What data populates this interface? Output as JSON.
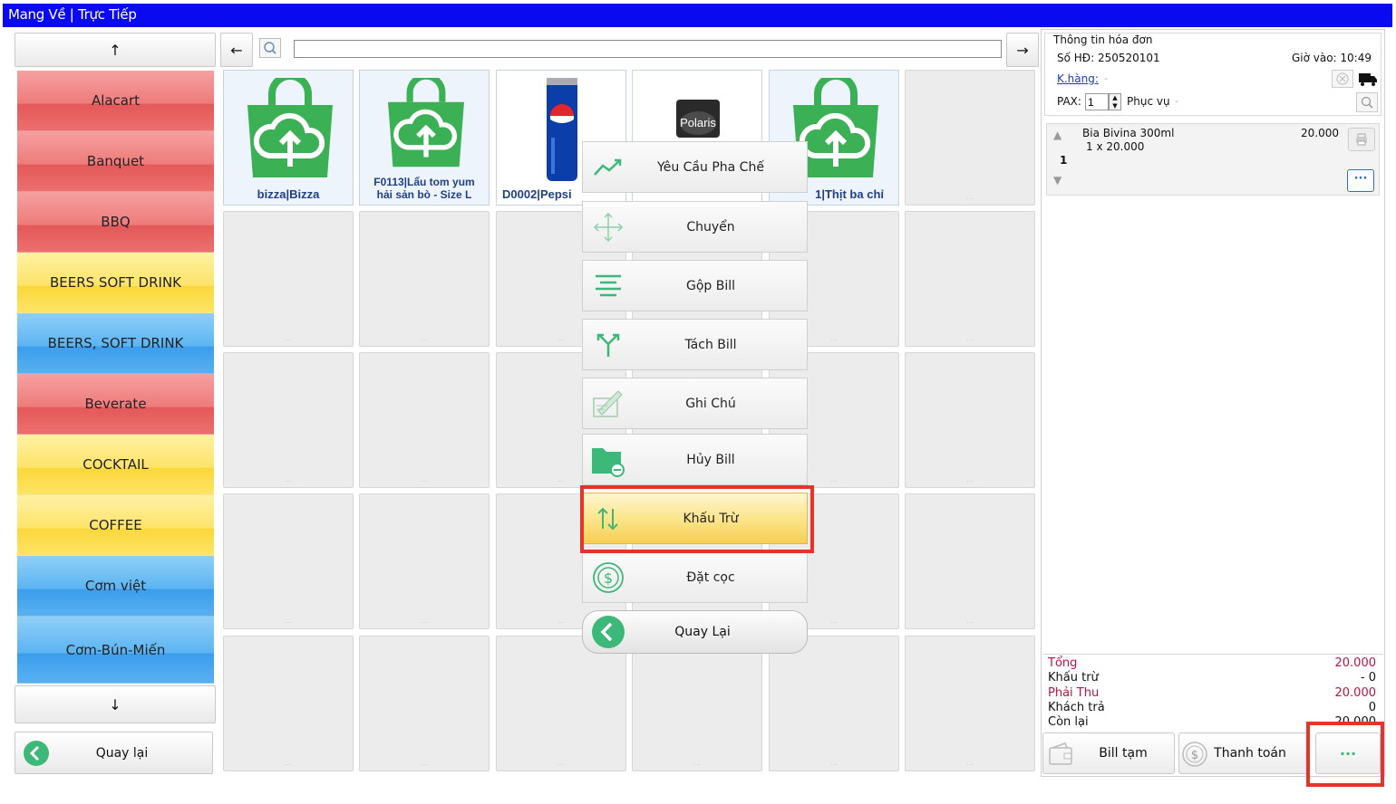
{
  "title": "Mang Về | Trực Tiếp",
  "sidebar": {
    "up_arrow": "↑",
    "down_arrow": "↓",
    "back_label": "Quay lại",
    "categories": [
      {
        "label": "Alacart",
        "color": "red"
      },
      {
        "label": "Banquet",
        "color": "red"
      },
      {
        "label": "BBQ",
        "color": "red"
      },
      {
        "label": "BEERS SOFT DRINK",
        "color": "yellow"
      },
      {
        "label": "BEERS, SOFT DRINK",
        "color": "blue"
      },
      {
        "label": "Beverate",
        "color": "red"
      },
      {
        "label": "COCKTAIL",
        "color": "yellow"
      },
      {
        "label": "COFFEE",
        "color": "yellow"
      },
      {
        "label": "Cơm việt",
        "color": "blue"
      },
      {
        "label": "Cơm-Bún-Miến",
        "color": "blue"
      }
    ]
  },
  "search": {
    "left_arrow": "←",
    "right_arrow": "→",
    "value": ""
  },
  "products": [
    {
      "label": "bizza|Bizza",
      "icon": "cloud-bag-icon"
    },
    {
      "label": "F0113|Lẩu tom yum hải sản bò - Size L",
      "icon": "cloud-bag-icon"
    },
    {
      "label": "D0002|Pepsi",
      "icon": "pepsi-can-icon"
    },
    {
      "label": "",
      "icon": "polaris-can-icon"
    },
    {
      "label": "1|Thịt ba chỉ",
      "icon": "cloud-bag-icon"
    }
  ],
  "tile_placeholder": "...",
  "menu": {
    "items": [
      {
        "label": "Yêu Cầu Pha Chế",
        "icon": "trend-line-icon"
      },
      {
        "label": "Chuyển",
        "icon": "move-arrows-icon"
      },
      {
        "label": "Gộp Bill",
        "icon": "merge-lines-icon"
      },
      {
        "label": "Tách Bill",
        "icon": "split-arrows-icon"
      },
      {
        "label": "Ghi Chú",
        "icon": "note-pen-icon"
      },
      {
        "label": "Hủy Bill",
        "icon": "folder-minus-icon"
      },
      {
        "label": "Khấu Trừ",
        "icon": "up-down-arrows-icon",
        "highlighted": true
      },
      {
        "label": "Đặt cọc",
        "icon": "dollar-coin-icon"
      }
    ],
    "back_label": "Quay Lại"
  },
  "invoice": {
    "header": "Thông tin hóa đơn",
    "number_label": "Số HĐ: 250520101",
    "time_label": "Giờ vào: 10:49",
    "customer_label": "K.hàng:",
    "customer_value": "-",
    "pax_label": "PAX:",
    "pax_value": "1",
    "service_label": "Phục vụ",
    "service_value": "-",
    "items": [
      {
        "name": "Bia Bivina 300ml",
        "price": "20.000",
        "detail": "1 x 20.000",
        "qty": "1"
      }
    ],
    "more_label": "···"
  },
  "summary": {
    "rows": [
      {
        "label": "Tổng",
        "value": "20.000",
        "color": "#c0143c"
      },
      {
        "label": "Khấu trừ",
        "value": "- 0",
        "color": "#111111"
      },
      {
        "label": "Phải Thu",
        "value": "20.000",
        "color": "#c0143c"
      },
      {
        "label": "Khách trả",
        "value": "0",
        "color": "#111111"
      },
      {
        "label": "Còn lại",
        "value": "20.000",
        "color": "#111111"
      }
    ]
  },
  "footer": {
    "temp_bill_label": "Bill tạm",
    "pay_label": "Thanh toán",
    "more_label": "···"
  },
  "colors": {
    "titlebar": "#0a0af0",
    "highlight_box": "#e8322a",
    "accent_green": "#3cb878"
  }
}
